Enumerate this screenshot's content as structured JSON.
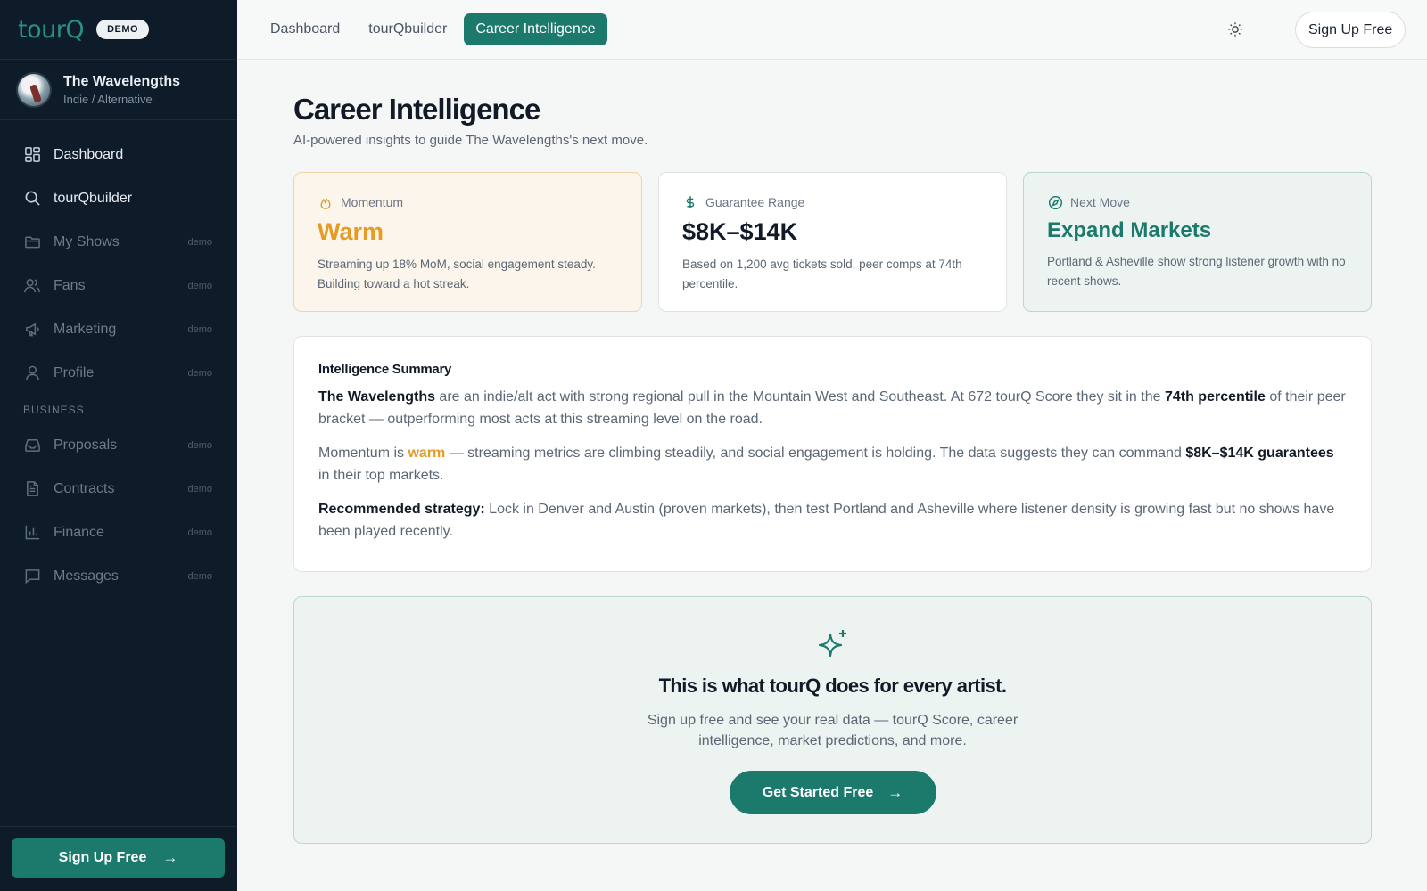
{
  "brand": {
    "logo": "tourQ",
    "badge": "DEMO"
  },
  "artist": {
    "name": "The Wavelengths",
    "genre": "Indie / Alternative"
  },
  "sidebar": {
    "items": [
      {
        "label": "Dashboard",
        "tag": "",
        "icon": "grid-icon"
      },
      {
        "label": "tourQbuilder",
        "tag": "",
        "icon": "search-icon"
      },
      {
        "label": "My Shows",
        "tag": "demo",
        "icon": "folder-icon"
      },
      {
        "label": "Fans",
        "tag": "demo",
        "icon": "users-icon"
      },
      {
        "label": "Marketing",
        "tag": "demo",
        "icon": "megaphone-icon"
      },
      {
        "label": "Profile",
        "tag": "demo",
        "icon": "user-icon"
      }
    ],
    "section_label": "BUSINESS",
    "business_items": [
      {
        "label": "Proposals",
        "tag": "demo",
        "icon": "inbox-icon"
      },
      {
        "label": "Contracts",
        "tag": "demo",
        "icon": "document-icon"
      },
      {
        "label": "Finance",
        "tag": "demo",
        "icon": "bar-chart-icon"
      },
      {
        "label": "Messages",
        "tag": "demo",
        "icon": "message-icon"
      }
    ],
    "cta_label": "Sign Up Free"
  },
  "topbar": {
    "tabs": [
      {
        "label": "Dashboard",
        "active": false
      },
      {
        "label": "tourQbuilder",
        "active": false
      },
      {
        "label": "Career Intelligence",
        "active": true
      }
    ],
    "signup_label": "Sign Up Free"
  },
  "page": {
    "title": "Career Intelligence",
    "subtitle": "AI-powered insights to guide The Wavelengths's next move."
  },
  "cards": [
    {
      "label": "Momentum",
      "value": "Warm",
      "desc": "Streaming up 18% MoM, social engagement steady. Building toward a hot streak.",
      "icon": "flame-icon",
      "color": "#e59c23"
    },
    {
      "label": "Guarantee Range",
      "value": "$8K–$14K",
      "desc": "Based on 1,200 avg tickets sold, peer comps at 74th percentile.",
      "icon": "dollar-icon"
    },
    {
      "label": "Next Move",
      "value": "Expand Markets",
      "desc": "Portland & Asheville show strong listener growth with no recent shows.",
      "icon": "compass-icon",
      "color": "#1c7a6c"
    }
  ],
  "summary": {
    "title": "Intelligence Summary",
    "p1": {
      "name": "The Wavelengths",
      "a": " are an indie/alt act with strong regional pull in the Mountain West and Southeast. At 672 tourQ Score they sit in the ",
      "b": "74th percentile",
      "c": " of their peer bracket — outperforming most acts at this streaming level on the road."
    },
    "p2": {
      "a": "Momentum is ",
      "warm": "warm",
      "b": " — streaming metrics are climbing steadily, and social engagement is holding. The data suggests they can command ",
      "c": "$8K–$14K guarantees",
      "d": " in their top markets."
    },
    "p3": {
      "label": "Recommended strategy:",
      "text": " Lock in Denver and Austin (proven markets), then test Portland and Asheville where listener density is growing fast but no shows have been played recently."
    }
  },
  "cta": {
    "title": "This is what tourQ does for every artist.",
    "subtitle": "Sign up free and see your real data — tourQ Score, career intelligence, market predictions, and more.",
    "button": "Get Started Free"
  },
  "colors": {
    "accent": "#1c7a6c",
    "warm": "#e59c23",
    "sidebar_bg": "#0e1b29"
  }
}
